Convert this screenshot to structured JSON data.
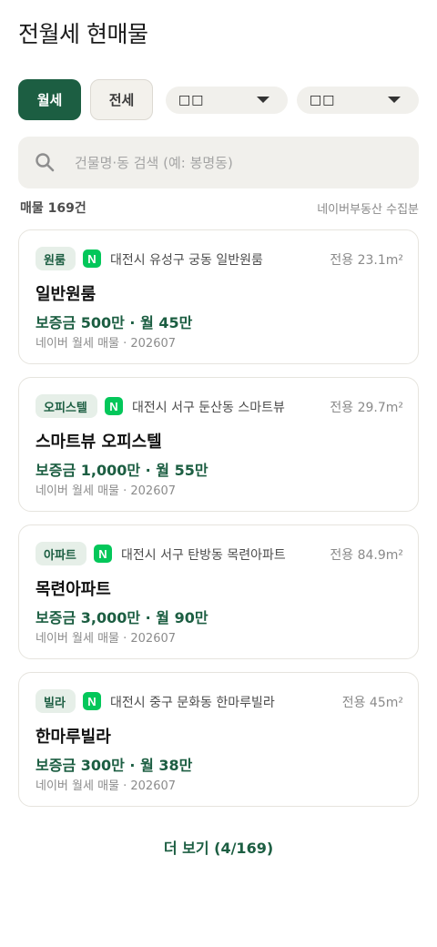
{
  "header": {
    "title": "전월세 현매물"
  },
  "filters": {
    "monthly_label": "월세",
    "jeonse_label": "전세",
    "dropdown1_value": "□□",
    "dropdown2_value": "□□"
  },
  "search": {
    "placeholder": "건물명·동 검색 (예: 봉명동)"
  },
  "meta": {
    "count_label": "매물 169건",
    "source_label": "네이버부동산 수집분"
  },
  "colors": {
    "accent": "#1c5e42",
    "naver_green": "#03c75a",
    "tag_bg": "#e6efe8"
  },
  "listings": [
    {
      "tag": "원룸",
      "address": "대전시 유성구 궁동 일반원룸",
      "area": "전용 23.1m²",
      "name": "일반원룸",
      "price": "보증금 500만 · 월 45만",
      "source": "네이버 월세 매물 · 202607"
    },
    {
      "tag": "오피스텔",
      "address": "대전시 서구 둔산동 스마트뷰",
      "area": "전용 29.7m²",
      "name": "스마트뷰 오피스텔",
      "price": "보증금 1,000만 · 월 55만",
      "source": "네이버 월세 매물 · 202607"
    },
    {
      "tag": "아파트",
      "address": "대전시 서구 탄방동 목련아파트",
      "area": "전용 84.9m²",
      "name": "목련아파트",
      "price": "보증금 3,000만 · 월 90만",
      "source": "네이버 월세 매물 · 202607"
    },
    {
      "tag": "빌라",
      "address": "대전시 중구 문화동 한마루빌라",
      "area": "전용 45m²",
      "name": "한마루빌라",
      "price": "보증금 300만 · 월 38만",
      "source": "네이버 월세 매물 · 202607"
    }
  ],
  "naver_badge": "N",
  "pagination": {
    "more_label": "더 보기 (4/169)"
  }
}
